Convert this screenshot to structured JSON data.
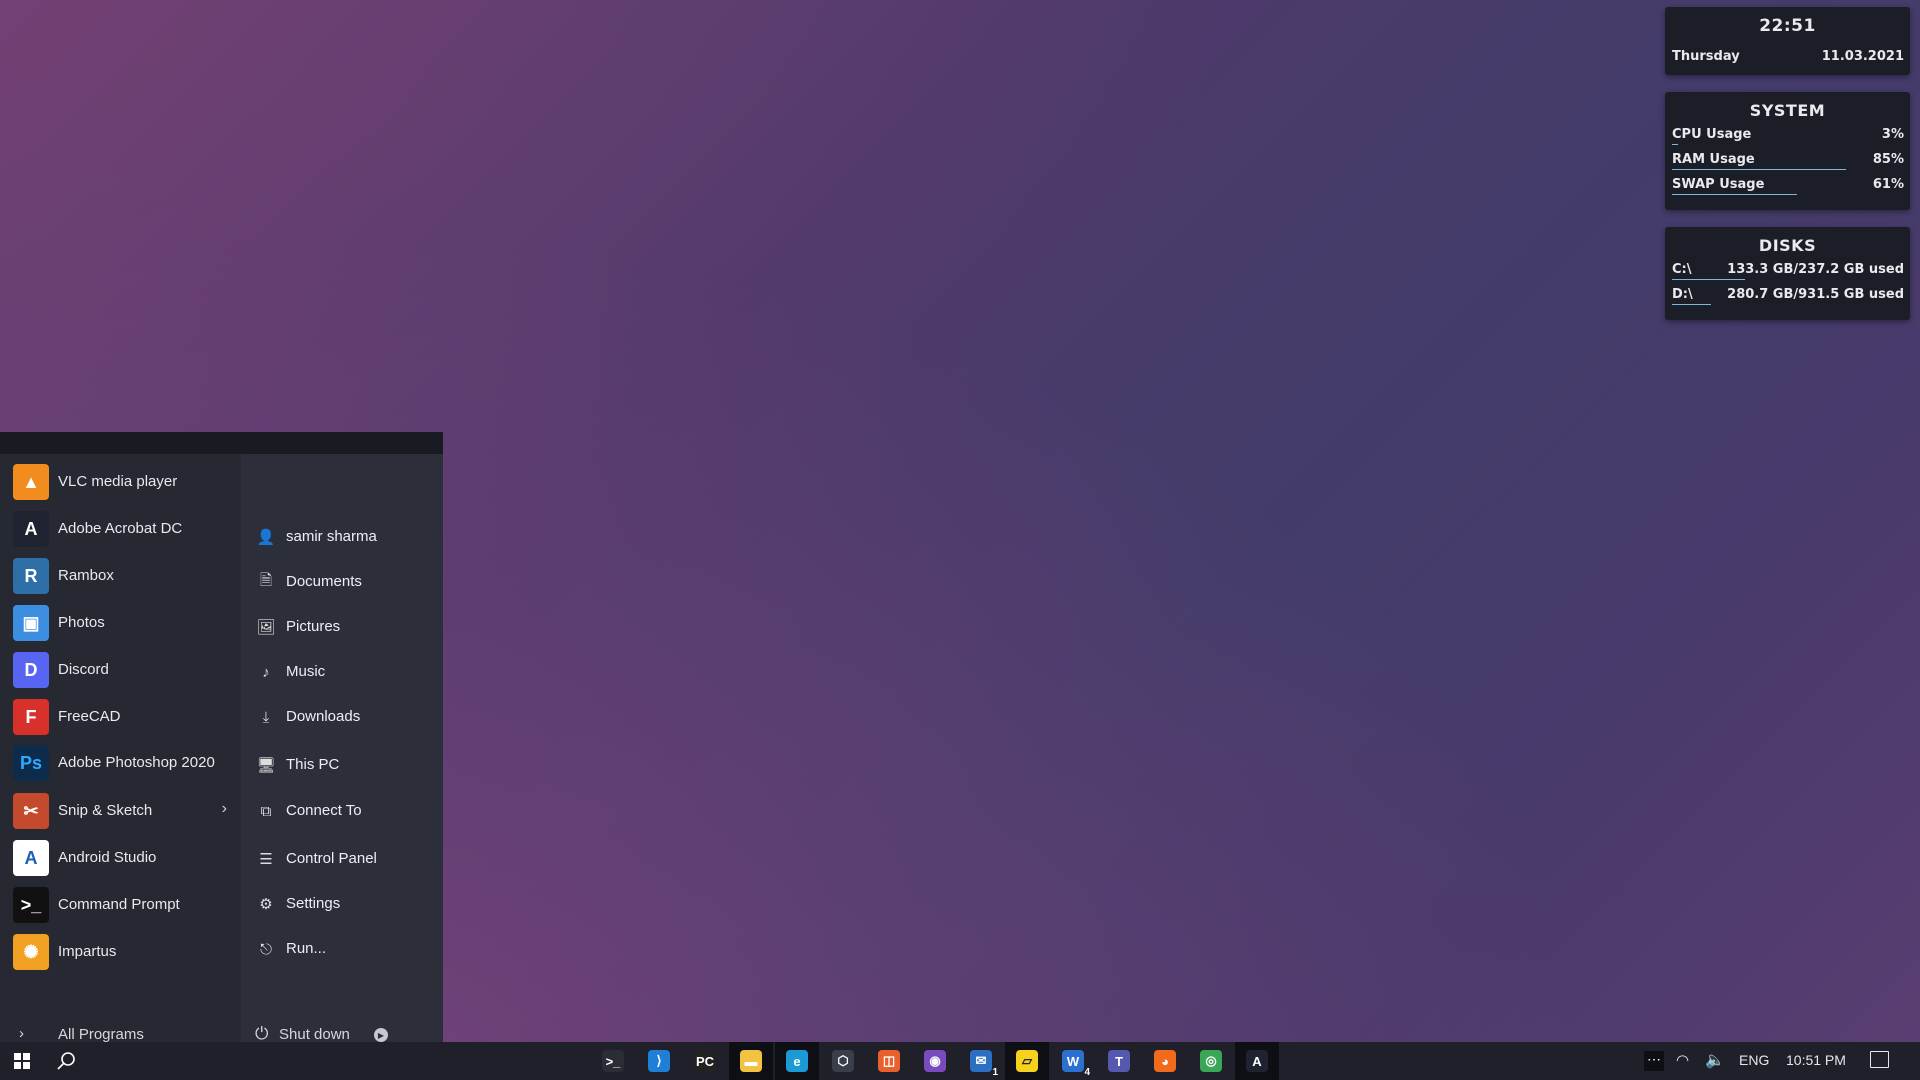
{
  "widgets": {
    "clock": {
      "time": "22:51",
      "day": "Thursday",
      "date": "11.03.2021"
    },
    "system": {
      "title": "SYSTEM",
      "rows": [
        {
          "label": "CPU Usage",
          "value": "3%",
          "fraction": 0.03
        },
        {
          "label": "RAM Usage",
          "value": "85%",
          "fraction": 0.85
        },
        {
          "label": "SWAP Usage",
          "value": "61%",
          "fraction": 0.61
        }
      ]
    },
    "disks": {
      "title": "DISKS",
      "rows": [
        {
          "label": "C:\\",
          "value": "133.3 GB/237.2 GB used",
          "fraction": 0.56
        },
        {
          "label": "D:\\",
          "value": "280.7 GB/931.5 GB used",
          "fraction": 0.3
        }
      ]
    }
  },
  "start_menu": {
    "apps": [
      {
        "label": "VLC media player",
        "icon": "vlc-icon",
        "color": "#f28c1e"
      },
      {
        "label": "Adobe Acrobat DC",
        "icon": "acrobat-icon",
        "color": "#1f2230"
      },
      {
        "label": "Rambox",
        "icon": "rambox-icon",
        "color": "#2f6fa8"
      },
      {
        "label": "Photos",
        "icon": "photos-icon",
        "color": "#3d8ee0"
      },
      {
        "label": "Discord",
        "icon": "discord-icon",
        "color": "#5865f2"
      },
      {
        "label": "FreeCAD",
        "icon": "freecad-icon",
        "color": "#d8302a"
      },
      {
        "label": "Adobe Photoshop 2020",
        "icon": "photoshop-icon",
        "color": "#0d2b4a"
      },
      {
        "label": "Snip & Sketch",
        "icon": "snip-icon",
        "color": "#c34a2c",
        "has_submenu": true
      },
      {
        "label": "Android Studio",
        "icon": "android-studio-icon",
        "color": "#ffffff"
      },
      {
        "label": "Command Prompt",
        "icon": "cmd-icon",
        "color": "#111111"
      },
      {
        "label": "Impartus",
        "icon": "impartus-icon",
        "color": "#f2a024"
      }
    ],
    "all_programs": "All Programs",
    "places": [
      {
        "label": "samir sharma",
        "icon": "user-icon",
        "glyph": "👤"
      },
      {
        "label": "Documents",
        "icon": "document-icon",
        "glyph": "🗎"
      },
      {
        "label": "Pictures",
        "icon": "picture-icon",
        "glyph": "🖼"
      },
      {
        "label": "Music",
        "icon": "music-icon",
        "glyph": "♪"
      },
      {
        "label": "Downloads",
        "icon": "download-icon",
        "glyph": "⤓"
      },
      {
        "label": "This PC",
        "icon": "computer-icon",
        "glyph": "🖥"
      },
      {
        "label": "Connect To",
        "icon": "connect-icon",
        "glyph": "⧉"
      },
      {
        "label": "Control Panel",
        "icon": "control-panel-icon",
        "glyph": "☰"
      },
      {
        "label": "Settings",
        "icon": "gear-icon",
        "glyph": "⚙"
      },
      {
        "label": "Run...",
        "icon": "run-icon",
        "glyph": "⎋"
      }
    ],
    "shutdown": "Shut down"
  },
  "taskbar": {
    "apps": [
      {
        "name": "terminal",
        "color": "#2a2c36",
        "glyph": ">_",
        "active": false
      },
      {
        "name": "vscode",
        "color": "#1f7fd6",
        "glyph": "⟩",
        "active": false
      },
      {
        "name": "pycharm",
        "color": "#222222",
        "glyph": "PC",
        "active": false
      },
      {
        "name": "file-explorer",
        "color": "#f2c340",
        "glyph": "▬",
        "active": true
      },
      {
        "name": "edge",
        "color": "#1c9ad6",
        "glyph": "e",
        "active": true
      },
      {
        "name": "3d-viewer",
        "color": "#3a3d4a",
        "glyph": "⬡",
        "active": false
      },
      {
        "name": "office",
        "color": "#e8602c",
        "glyph": "◫",
        "active": false
      },
      {
        "name": "hub-app",
        "color": "#7a4bbf",
        "glyph": "◉",
        "active": false
      },
      {
        "name": "mail",
        "color": "#2a6fc4",
        "glyph": "✉",
        "active": false,
        "badge": "1"
      },
      {
        "name": "sticky-notes",
        "color": "#f6d21c",
        "glyph": "▱",
        "active": true
      },
      {
        "name": "word",
        "color": "#2b6fd0",
        "glyph": "W",
        "active": false,
        "badge": "4"
      },
      {
        "name": "teams",
        "color": "#5558af",
        "glyph": "T",
        "active": false
      },
      {
        "name": "firefox",
        "color": "#f26a1b",
        "glyph": "◕",
        "active": false
      },
      {
        "name": "chrome",
        "color": "#3aa757",
        "glyph": "◎",
        "active": false
      },
      {
        "name": "acrobat",
        "color": "#1f2230",
        "glyph": "A",
        "active": true
      }
    ],
    "tray": {
      "language": "ENG",
      "time": "10:51 PM"
    }
  }
}
